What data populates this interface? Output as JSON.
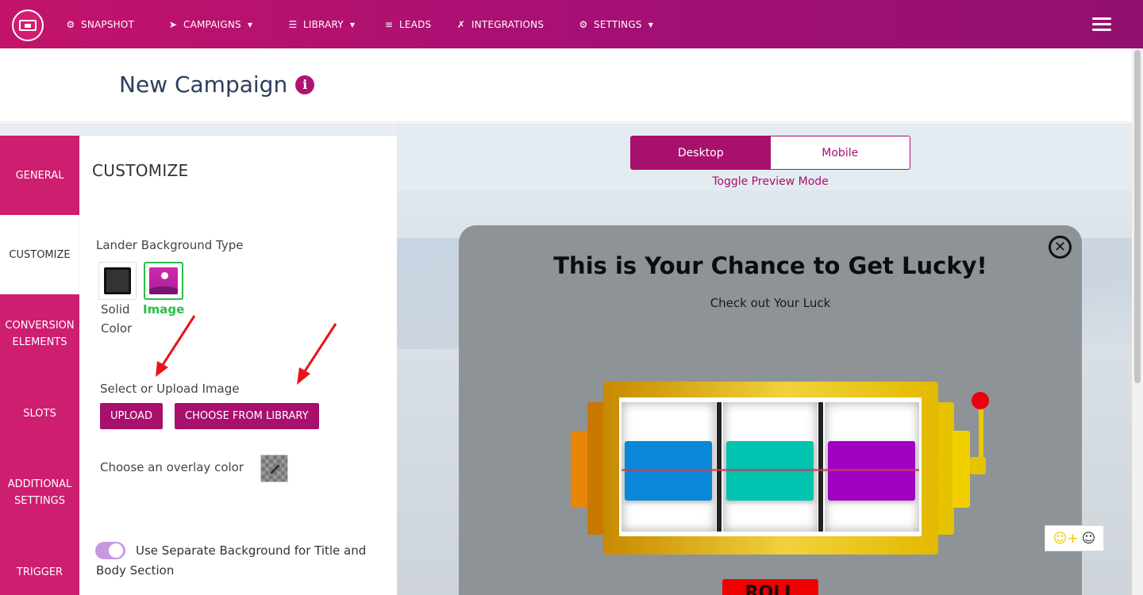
{
  "nav": {
    "items": [
      {
        "label": "SNAPSHOT",
        "icon": "dashboard-icon",
        "caret": false
      },
      {
        "label": "CAMPAIGNS",
        "icon": "paper-plane-icon",
        "caret": true
      },
      {
        "label": "LIBRARY",
        "icon": "server-icon",
        "caret": true
      },
      {
        "label": "LEADS",
        "icon": "list-icon",
        "caret": false
      },
      {
        "label": "INTEGRATIONS",
        "icon": "plug-icon",
        "caret": false
      },
      {
        "label": "SETTINGS",
        "icon": "cogs-icon",
        "caret": true
      }
    ]
  },
  "header": {
    "title": "New Campaign"
  },
  "tabs": [
    {
      "label": "GENERAL"
    },
    {
      "label": "CUSTOMIZE",
      "active": true
    },
    {
      "label": "CONVERSION ELEMENTS"
    },
    {
      "label": "SLOTS"
    },
    {
      "label": "ADDITIONAL SETTINGS"
    },
    {
      "label": "TRIGGER"
    }
  ],
  "panel": {
    "title": "CUSTOMIZE",
    "bg_type_label": "Lander Background Type",
    "bg_options": [
      {
        "label": "Solid Color",
        "selected": false
      },
      {
        "label": "Image",
        "selected": true
      }
    ],
    "select_upload_label": "Select or Upload Image",
    "upload_button": "UPLOAD",
    "library_button": "CHOOSE FROM LIBRARY",
    "overlay_label": "Choose an overlay color",
    "separate_bg_label": "Use Separate Background for Title and Body Section",
    "separate_bg_enabled": true
  },
  "preview": {
    "modes": [
      "Desktop",
      "Mobile"
    ],
    "active_mode": "Desktop",
    "toggle_caption": "Toggle Preview Mode",
    "modal_title": "This is Your Chance to Get Lucky!",
    "modal_subtitle": "Check out Your Luck",
    "roll_button": "ROLL",
    "reel_colors": [
      "#0a87d8",
      "#00c4b0",
      "#a000c0"
    ]
  },
  "colors": {
    "brand": "#a8106e",
    "tab_bg": "#cd1e6f",
    "selected_outline": "#26c049",
    "image_option_text": "#26c049"
  }
}
